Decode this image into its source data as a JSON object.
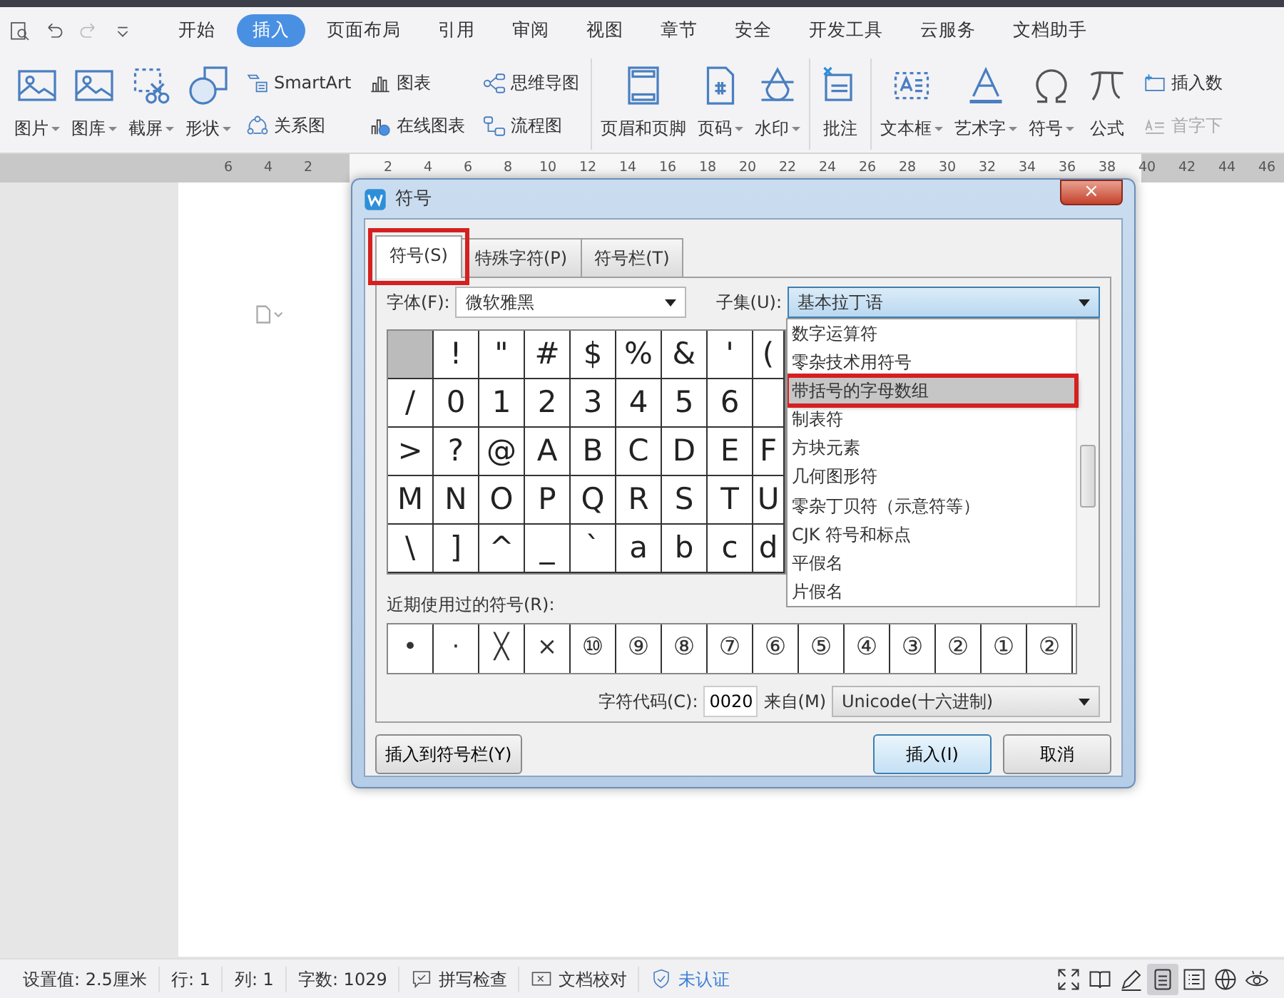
{
  "menu": {
    "tabs": [
      {
        "label": "开始",
        "selected": false
      },
      {
        "label": "插入",
        "selected": true
      },
      {
        "label": "页面布局",
        "selected": false
      },
      {
        "label": "引用",
        "selected": false
      },
      {
        "label": "审阅",
        "selected": false
      },
      {
        "label": "视图",
        "selected": false
      },
      {
        "label": "章节",
        "selected": false
      },
      {
        "label": "安全",
        "selected": false
      },
      {
        "label": "开发工具",
        "selected": false
      },
      {
        "label": "云服务",
        "selected": false
      },
      {
        "label": "文档助手",
        "selected": false
      }
    ]
  },
  "ribbon": {
    "groups": [
      {
        "columns": [
          {
            "kind": "large",
            "label": "图片",
            "dropdown": true
          },
          {
            "kind": "large",
            "label": "图库",
            "dropdown": true
          },
          {
            "kind": "large",
            "label": "截屏",
            "dropdown": true
          },
          {
            "kind": "large",
            "label": "形状",
            "dropdown": true
          },
          {
            "kind": "stack",
            "items": [
              {
                "label": "SmartArt",
                "disabled": false
              },
              {
                "label": "关系图",
                "disabled": false
              }
            ]
          },
          {
            "kind": "stack",
            "items": [
              {
                "label": "图表",
                "disabled": false
              },
              {
                "label": "在线图表",
                "disabled": false
              }
            ]
          },
          {
            "kind": "stack",
            "items": [
              {
                "label": "思维导图",
                "disabled": false
              },
              {
                "label": "流程图",
                "disabled": false
              }
            ]
          }
        ]
      },
      {
        "columns": [
          {
            "kind": "large",
            "label": "页眉和页脚",
            "dropdown": false
          },
          {
            "kind": "large",
            "label": "页码",
            "dropdown": true
          },
          {
            "kind": "large",
            "label": "水印",
            "dropdown": true
          }
        ]
      },
      {
        "columns": [
          {
            "kind": "large",
            "label": "批注",
            "dropdown": false
          }
        ]
      },
      {
        "columns": [
          {
            "kind": "large",
            "label": "文本框",
            "dropdown": true
          },
          {
            "kind": "large",
            "label": "艺术字",
            "dropdown": true
          },
          {
            "kind": "large",
            "label": "符号",
            "dropdown": true
          },
          {
            "kind": "large",
            "label": "公式",
            "dropdown": false
          },
          {
            "kind": "stack",
            "items": [
              {
                "label": "插入数",
                "disabled": false
              },
              {
                "label": "首字下",
                "disabled": true
              }
            ]
          }
        ]
      }
    ]
  },
  "ruler": {
    "left_marks": [
      "6",
      "4",
      "2"
    ],
    "right_marks": [
      "2",
      "4",
      "6",
      "8",
      "10",
      "12",
      "14",
      "16",
      "18",
      "20",
      "22",
      "24",
      "26",
      "28",
      "30",
      "32",
      "34",
      "36",
      "38",
      "40",
      "42",
      "44",
      "46"
    ]
  },
  "dialog": {
    "title": "符号",
    "close": "×",
    "tabs": [
      {
        "label": "符号(S)",
        "selected": true,
        "annotated": true
      },
      {
        "label": "特殊字符(P)",
        "selected": false,
        "annotated": false
      },
      {
        "label": "符号栏(T)",
        "selected": false,
        "annotated": false
      }
    ],
    "font_label": "字体(F):",
    "font_value": "微软雅黑",
    "subset_label": "子集(U):",
    "subset_value": "基本拉丁语",
    "subset_list": [
      {
        "label": "数字运算符",
        "selected": false,
        "annotated": false
      },
      {
        "label": "零杂技术用符号",
        "selected": false,
        "annotated": false
      },
      {
        "label": "带括号的字母数组",
        "selected": true,
        "annotated": true
      },
      {
        "label": "制表符",
        "selected": false,
        "annotated": false
      },
      {
        "label": "方块元素",
        "selected": false,
        "annotated": false
      },
      {
        "label": "几何图形符",
        "selected": false,
        "annotated": false
      },
      {
        "label": "零杂丁贝符（示意符等）",
        "selected": false,
        "annotated": false
      },
      {
        "label": "CJK 符号和标点",
        "selected": false,
        "annotated": false
      },
      {
        "label": "平假名",
        "selected": false,
        "annotated": false
      },
      {
        "label": "片假名",
        "selected": false,
        "annotated": false
      }
    ],
    "symbol_rows": [
      [
        {
          "selected": true
        },
        {
          "char": "!",
          "selected": false
        },
        {
          "char": "\"",
          "selected": false
        },
        {
          "char": "#",
          "selected": false
        },
        {
          "char": "$",
          "selected": false
        },
        {
          "char": "%",
          "selected": false
        },
        {
          "char": "&",
          "selected": false
        },
        {
          "char": "'",
          "selected": false
        },
        {
          "char": "(",
          "selected": false
        }
      ],
      [
        {
          "char": "/",
          "selected": false
        },
        {
          "char": "0",
          "selected": false
        },
        {
          "char": "1",
          "selected": false
        },
        {
          "char": "2",
          "selected": false
        },
        {
          "char": "3",
          "selected": false
        },
        {
          "char": "4",
          "selected": false
        },
        {
          "char": "5",
          "selected": false
        },
        {
          "char": "6",
          "selected": false
        }
      ],
      [
        {
          "char": ">",
          "selected": false
        },
        {
          "char": "?",
          "selected": false
        },
        {
          "char": "@",
          "selected": false
        },
        {
          "char": "A",
          "selected": false
        },
        {
          "char": "B",
          "selected": false
        },
        {
          "char": "C",
          "selected": false
        },
        {
          "char": "D",
          "selected": false
        },
        {
          "char": "E",
          "selected": false
        },
        {
          "char": "F",
          "selected": false
        }
      ],
      [
        {
          "char": "M",
          "selected": false
        },
        {
          "char": "N",
          "selected": false
        },
        {
          "char": "O",
          "selected": false
        },
        {
          "char": "P",
          "selected": false
        },
        {
          "char": "Q",
          "selected": false
        },
        {
          "char": "R",
          "selected": false
        },
        {
          "char": "S",
          "selected": false
        },
        {
          "char": "T",
          "selected": false
        },
        {
          "char": "U",
          "selected": false
        }
      ],
      [
        {
          "char": "\\",
          "selected": false
        },
        {
          "char": "]",
          "selected": false
        },
        {
          "char": "^",
          "selected": false
        },
        {
          "char": "_",
          "selected": false
        },
        {
          "char": "`",
          "selected": false
        },
        {
          "char": "a",
          "selected": false
        },
        {
          "char": "b",
          "selected": false
        },
        {
          "char": "c",
          "selected": false
        },
        {
          "char": "d",
          "selected": false
        }
      ]
    ],
    "recent_label": "近期使用过的符号(R):",
    "recent": [
      "•",
      "·",
      "╳",
      "×",
      "⑩",
      "⑨",
      "⑧",
      "⑦",
      "⑥",
      "⑤",
      "④",
      "③",
      "②",
      "①",
      "②"
    ],
    "code_label": "字符代码(C):",
    "code_value": "0020",
    "from_label": "来自(M)",
    "from_value": "Unicode(十六进制)",
    "buttons": [
      {
        "label": "插入到符号栏(Y)",
        "kind": "left",
        "default": false
      },
      {
        "label": "插入(I)",
        "kind": "right",
        "default": true
      },
      {
        "label": "取消",
        "kind": "right",
        "default": false
      }
    ]
  },
  "status_bar": {
    "items": [
      {
        "kind": "text",
        "label": "设置值: 2.5厘米"
      },
      {
        "kind": "text",
        "label": "行: 1"
      },
      {
        "kind": "text",
        "label": "列: 1"
      },
      {
        "kind": "text",
        "label": "字数: 1029"
      },
      {
        "kind": "spell",
        "label": "拼写检查"
      },
      {
        "kind": "proof",
        "label": "文档校对"
      },
      {
        "kind": "cert",
        "label": "未认证"
      }
    ],
    "view_buttons": [
      {
        "selected": false
      },
      {
        "selected": false
      },
      {
        "selected": false
      },
      {
        "selected": true
      },
      {
        "selected": false
      },
      {
        "selected": false
      },
      {
        "selected": false
      }
    ]
  }
}
